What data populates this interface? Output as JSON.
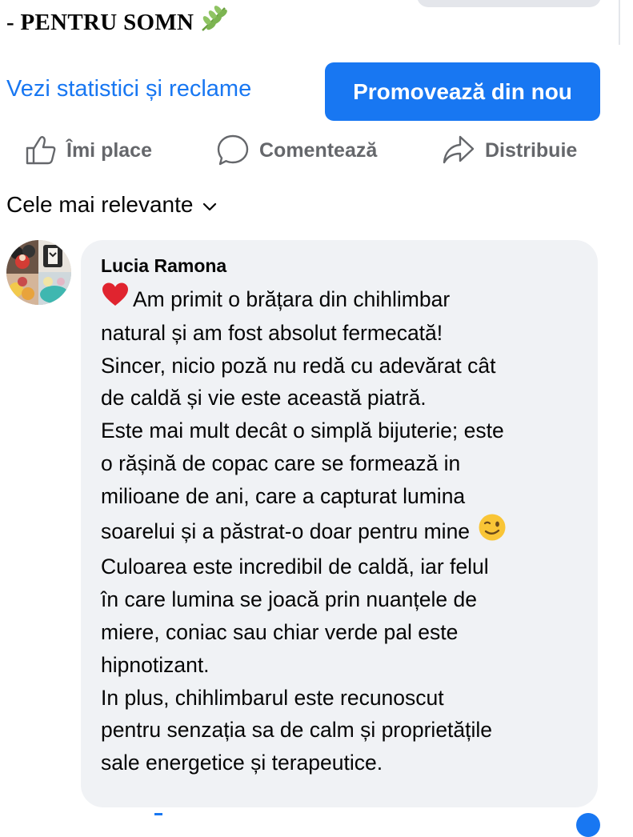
{
  "post": {
    "title": "- PENTRU SOMN",
    "leaf_icon": "herb-icon"
  },
  "promo": {
    "stats_link": "Vezi statistici și reclame",
    "promote_button": "Promovează din nou"
  },
  "actions": {
    "like": {
      "label": "Îmi place",
      "icon": "thumbs-up-icon"
    },
    "comment": {
      "label": "Comentează",
      "icon": "comment-bubble-icon"
    },
    "share": {
      "label": "Distribuie",
      "icon": "share-arrow-icon"
    }
  },
  "comments_filter": {
    "label": "Cele mai relevante",
    "icon": "chevron-down-icon"
  },
  "comment": {
    "author": "Lucia Ramona",
    "lines": [
      "Am primit o brățara din chihlimbar",
      "natural și am fost absolut fermecată!",
      "Sincer, nicio poză nu redă cu adevărat cât",
      "de caldă și vie este această piatră.",
      "Este mai mult decât o simplă bijuterie; este",
      "o rășină de copac care se formează in",
      "milioane de ani, care a capturat lumina",
      "soarelui și a păstrat-o doar pentru mine",
      "Culoarea este incredibil de caldă, iar felul",
      "în care lumina se joacă prin nuanțele de",
      "miere, coniac sau chiar verde pal este",
      "hipnotizant.",
      "In plus, chihlimbarul este recunoscut",
      "pentru senzația sa de calm și proprietățile",
      "sale energetice și terapeutice."
    ],
    "emojis": {
      "first_line": "red-heart-icon",
      "eighth_line": "winking-face-icon"
    }
  },
  "colors": {
    "accent": "#1877f2",
    "action_gray": "#65676b",
    "bubble_bg": "#f0f2f5",
    "text": "#050505"
  }
}
